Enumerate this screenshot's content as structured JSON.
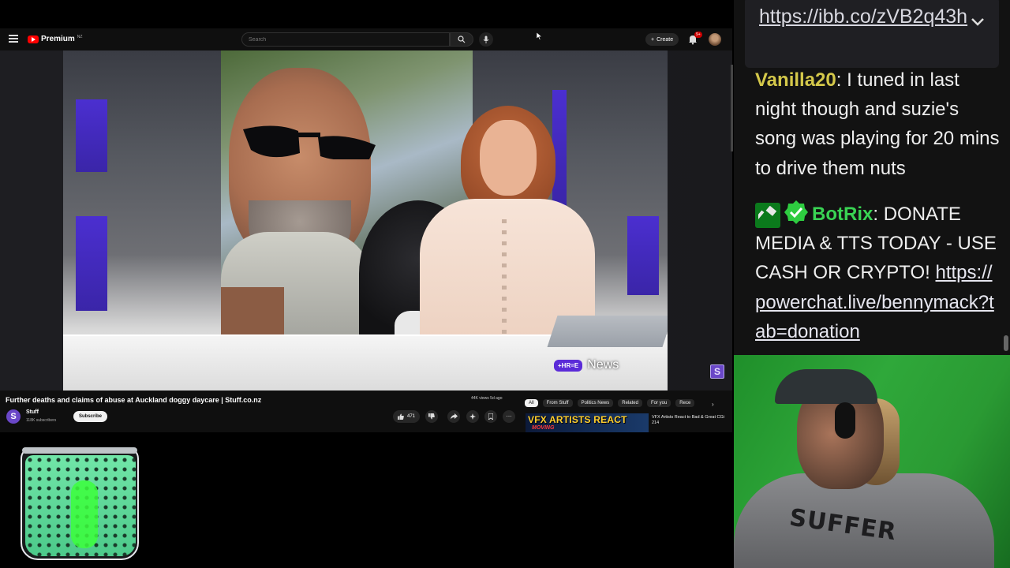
{
  "youtube": {
    "logo_text": "Premium",
    "logo_region": "NZ",
    "search_placeholder": "Search",
    "create_label": "Create",
    "notif_count": "9+",
    "video_title": "Further deaths and claims of abuse at Auckland doggy daycare | Stuff.co.nz",
    "channel_initial": "S",
    "channel_name": "Stuff",
    "channel_subs": "118K subscribers",
    "subscribe_label": "Subscribe",
    "like_count": "471",
    "views_line": "44K views  5d ago",
    "news_logo": "+HR=E",
    "news_label": "News",
    "watermark": "S",
    "chips": [
      "All",
      "From Stuff",
      "Politics News",
      "Related",
      "For you",
      "Rece"
    ],
    "rec_thumb_text": "VFX ARTISTS REACT",
    "rec_thumb_sub": "MOVING",
    "rec_title": "VFX Artists React to Bad & Great CGi 214"
  },
  "chat": {
    "pinned_link": "https://ibb.co/zVB2q43h",
    "messages": [
      {
        "user": "Vanilla20",
        "text": "I tuned in last night though and suzie's song was playing for 20 mins to drive them nuts"
      },
      {
        "user": "BotRix",
        "text": "DONATE MEDIA & TTS TODAY - USE CASH OR CRYPTO!",
        "link": "https://powerchat.live/bennymack?tab=donation"
      }
    ]
  },
  "webcam": {
    "shirt_text": "SUFFER"
  },
  "colors": {
    "youtube_red": "#ff0000",
    "chat_user_vanilla": "#d4c84a",
    "chat_user_botrix": "#39d353",
    "news_purple": "#5b2bd8",
    "greenscreen": "#2fa83a"
  }
}
